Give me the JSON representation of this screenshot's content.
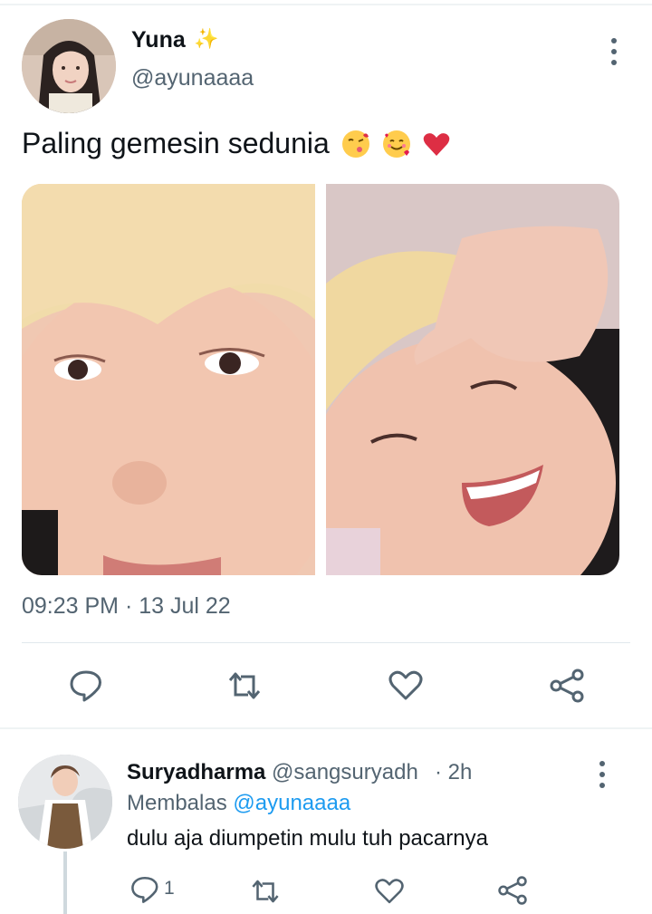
{
  "tweet": {
    "author_name": "Yuna",
    "author_handle": "@ayunaaaa",
    "text": "Paling gemesin sedunia",
    "emojis": [
      "kissing-face-icon",
      "smiling-face-with-hearts-icon",
      "red-heart-icon"
    ],
    "timestamp": "09:23 PM · 13 Jul 22",
    "photos": [
      "photo-1",
      "photo-2"
    ]
  },
  "actions": [
    "reply-icon",
    "retweet-icon",
    "like-icon",
    "share-icon"
  ],
  "reply": {
    "author_name": "Suryadharma",
    "author_handle": "@sangsuryadh",
    "time": "· 2h",
    "replying_prefix": "Membalas",
    "replying_to": "@ayunaaaa",
    "text": "dulu aja diumpetin mulu tuh pacarnya",
    "reply_count": "1"
  },
  "colors": {
    "text": "#0f1419",
    "muted": "#536471",
    "link": "#1d9bf0",
    "divider": "#e1e8ed"
  }
}
